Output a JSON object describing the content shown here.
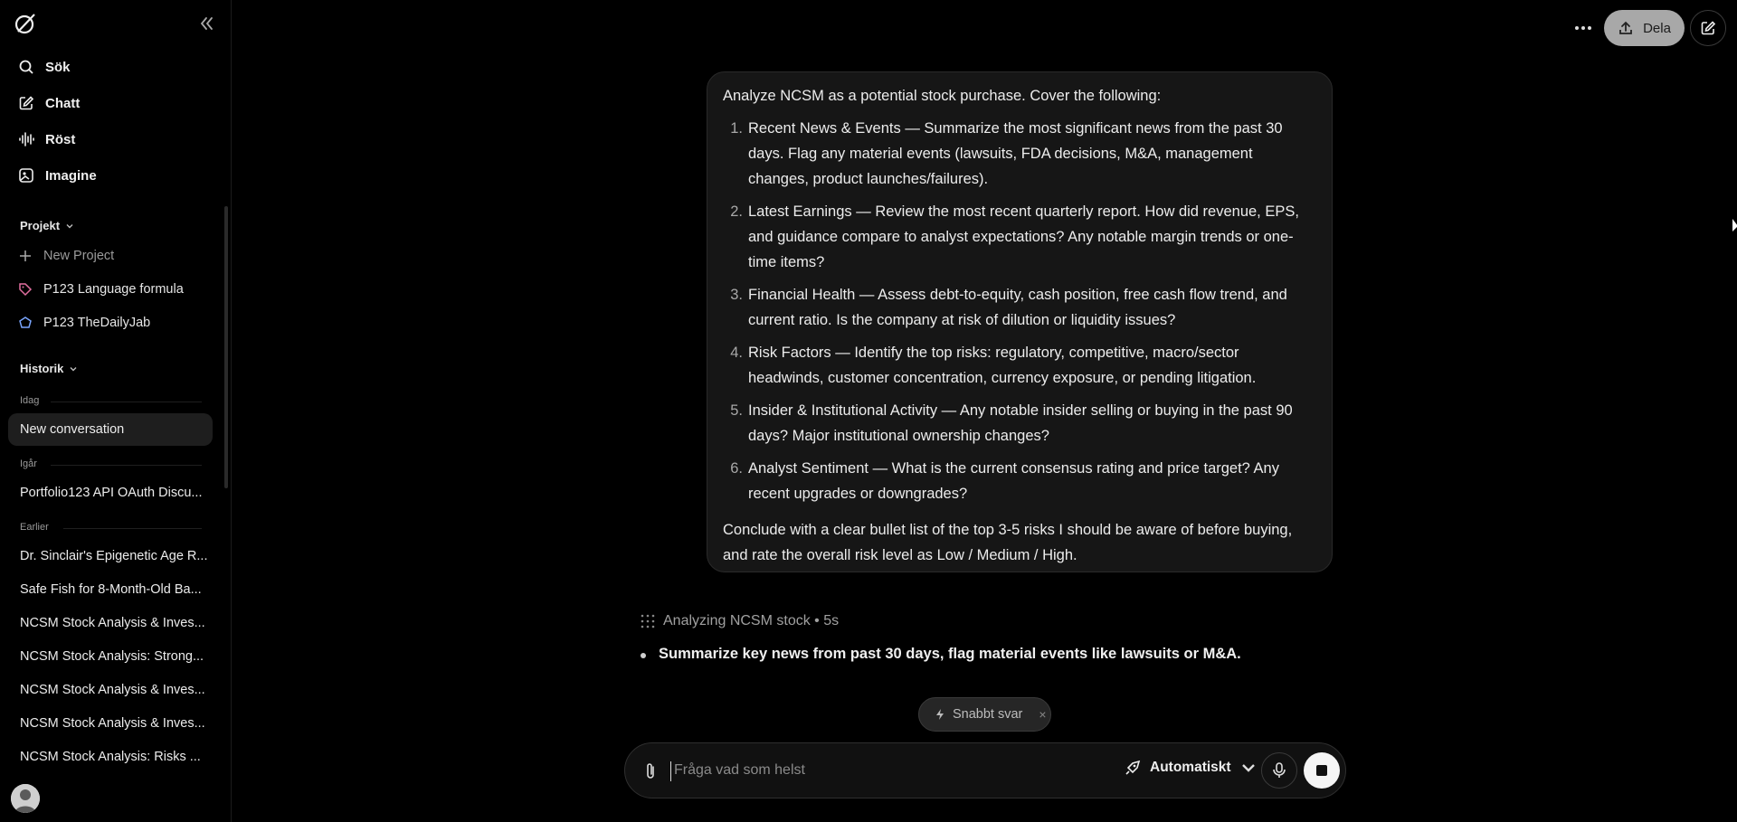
{
  "sidebar": {
    "nav": [
      {
        "label": "Sök",
        "icon": "search-icon"
      },
      {
        "label": "Chatt",
        "icon": "chat-edit-icon"
      },
      {
        "label": "Röst",
        "icon": "voice-waveform-icon"
      },
      {
        "label": "Imagine",
        "icon": "imagine-icon"
      }
    ],
    "projects_label": "Projekt",
    "projects": [
      {
        "label": "New Project",
        "icon": "plus-icon"
      },
      {
        "label": "P123 Language formula",
        "icon": "tag-icon"
      },
      {
        "label": "P123 TheDailyJab",
        "icon": "gem-icon"
      }
    ],
    "history_label": "Historik",
    "groups": [
      {
        "label": "Idag",
        "items": [
          "New conversation"
        ]
      },
      {
        "label": "Igår",
        "items": [
          "Portfolio123 API OAuth Discu..."
        ]
      },
      {
        "label": "Earlier",
        "items": [
          "Dr. Sinclair's Epigenetic Age R...",
          "Safe Fish for 8-Month-Old Ba...",
          "NCSM Stock Analysis & Inves...",
          "NCSM Stock Analysis: Strong...",
          "NCSM Stock Analysis & Inves...",
          "NCSM Stock Analysis & Inves...",
          "NCSM Stock Analysis: Risks ..."
        ]
      }
    ]
  },
  "header": {
    "share_label": "Dela"
  },
  "message": {
    "intro": "Analyze NCSM as a potential stock purchase. Cover the following:",
    "items": [
      {
        "num": "1.",
        "text": "Recent News & Events — Summarize the most significant news from the past 30 days. Flag any material events (lawsuits, FDA decisions, M&A, management changes, product launches/failures)."
      },
      {
        "num": "2.",
        "text": "Latest Earnings — Review the most recent quarterly report. How did revenue, EPS, and guidance compare to analyst expectations? Any notable margin trends or one-time items?"
      },
      {
        "num": "3.",
        "text": "Financial Health — Assess debt-to-equity, cash position, free cash flow trend, and current ratio. Is the company at risk of dilution or liquidity issues?"
      },
      {
        "num": "4.",
        "text": "Risk Factors — Identify the top risks: regulatory, competitive, macro/sector headwinds, customer concentration, currency exposure, or pending litigation."
      },
      {
        "num": "5.",
        "text": "Insider & Institutional Activity — Any notable insider selling or buying in the past 90 days? Major institutional ownership changes?"
      },
      {
        "num": "6.",
        "text": "Analyst Sentiment — What is the current consensus rating and price target? Any recent upgrades or downgrades?"
      }
    ],
    "outro": "Conclude with a clear bullet list of the top 3-5 risks I should be aware of before buying, and rate the overall risk level as Low / Medium / High."
  },
  "status": {
    "thinking": "Analyzing NCSM stock • 5s",
    "bullet": "Summarize key news from past 30 days, flag material events like lawsuits or M&A."
  },
  "chip": {
    "label": "Snabbt svar",
    "close": "×"
  },
  "composer": {
    "placeholder": "Fråga vad som helst",
    "value": "",
    "mode": "Automatiskt"
  }
}
